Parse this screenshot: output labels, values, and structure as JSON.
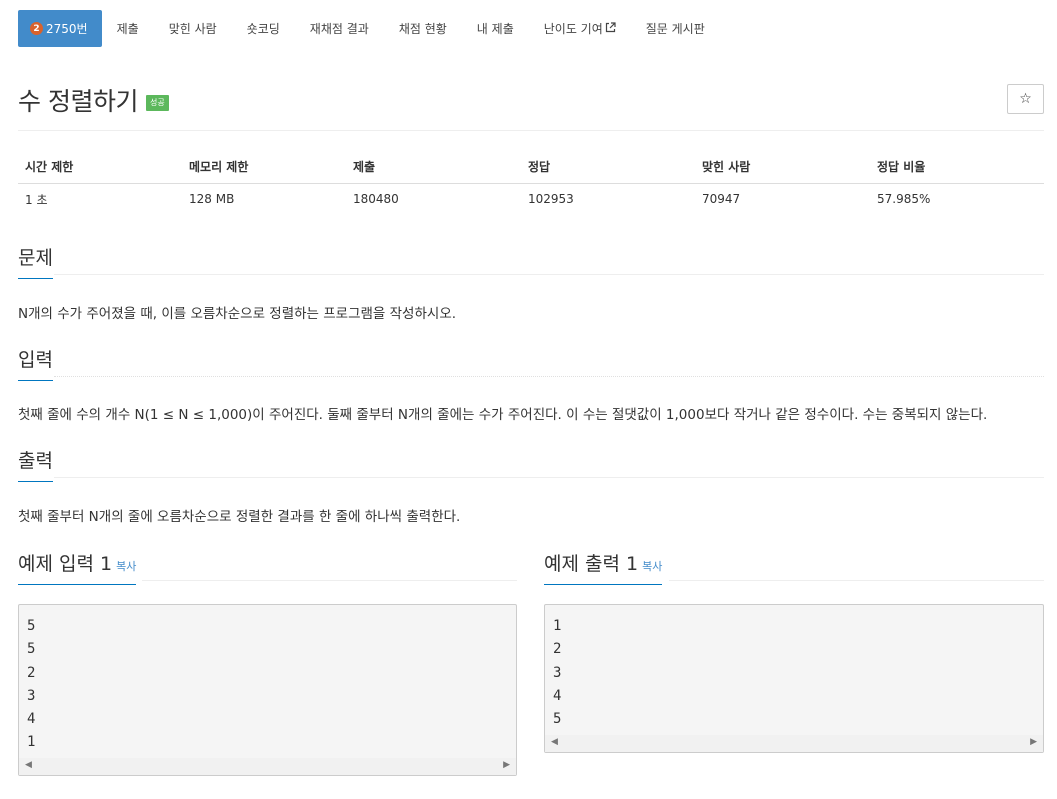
{
  "nav": {
    "problem_number": "2750번",
    "tier_label": "2",
    "items": [
      "제출",
      "맞힌 사람",
      "숏코딩",
      "재채점 결과",
      "채점 현황",
      "내 제출",
      "난이도 기여",
      "질문 게시판"
    ]
  },
  "problem": {
    "title": "수 정렬하기",
    "status_badge": "성공",
    "star_label": "☆"
  },
  "info_table": {
    "headers": [
      "시간 제한",
      "메모리 제한",
      "제출",
      "정답",
      "맞힌 사람",
      "정답 비율"
    ],
    "values": [
      "1 초",
      "128 MB",
      "180480",
      "102953",
      "70947",
      "57.985%"
    ]
  },
  "sections": {
    "description": {
      "heading": "문제",
      "text": "N개의 수가 주어졌을 때, 이를 오름차순으로 정렬하는 프로그램을 작성하시오."
    },
    "input": {
      "heading": "입력",
      "text": "첫째 줄에 수의 개수 N(1 ≤ N ≤ 1,000)이 주어진다. 둘째 줄부터 N개의 줄에는 수가 주어진다. 이 수는 절댓값이 1,000보다 작거나 같은 정수이다. 수는 중복되지 않는다."
    },
    "output": {
      "heading": "출력",
      "text": "첫째 줄부터 N개의 줄에 오름차순으로 정렬한 결과를 한 줄에 하나씩 출력한다."
    }
  },
  "samples": {
    "input": {
      "heading": "예제 입력 1",
      "copy_label": "복사",
      "lines": [
        "5",
        "5",
        "2",
        "3",
        "4",
        "1"
      ]
    },
    "output": {
      "heading": "예제 출력 1",
      "copy_label": "복사",
      "lines": [
        "1",
        "2",
        "3",
        "4",
        "5"
      ]
    }
  },
  "colors": {
    "nav_active": "#428bca",
    "tier_badge": "#d9622c",
    "success_badge": "#5cb85c",
    "heading_underline": "#0076c0",
    "link": "#428bca"
  },
  "icons": {
    "external": "external-link-icon",
    "star": "star-outline-icon",
    "scroll_left": "arrow-left-icon",
    "scroll_right": "arrow-right-icon"
  }
}
